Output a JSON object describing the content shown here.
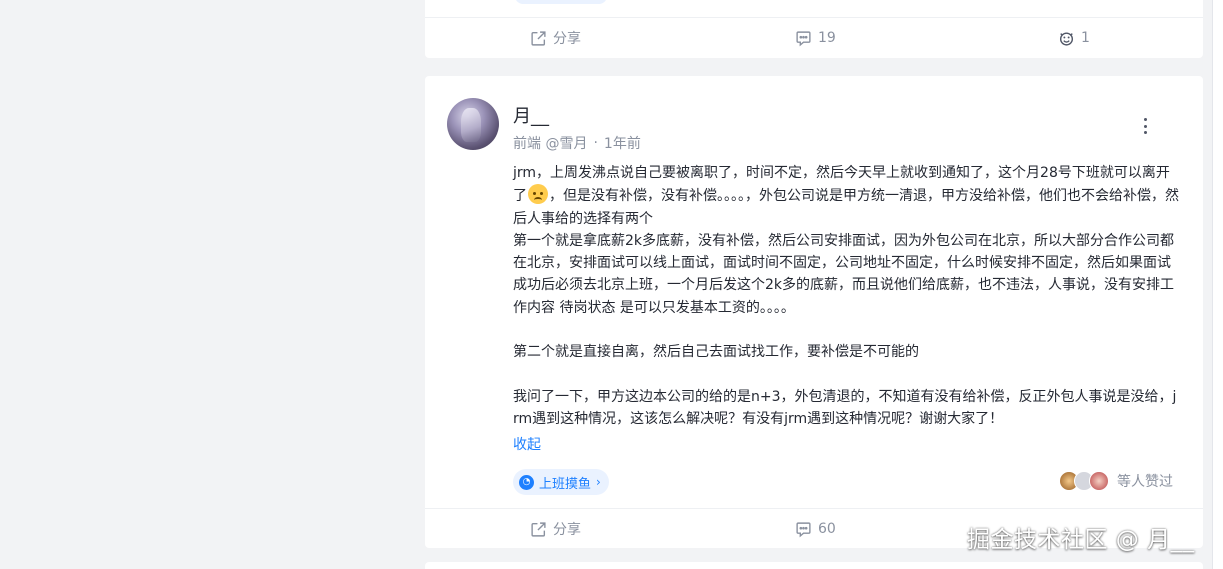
{
  "prev_post": {
    "actions": {
      "share_label": "分享",
      "comment_count": "19",
      "like_count": "1"
    }
  },
  "post": {
    "author": {
      "name": "月__",
      "title": "前端 @雪月",
      "separator": "·",
      "time": "1年前"
    },
    "content": {
      "p1a": "jrm，上周发沸点说自己要被离职了，时间不定，然后今天早上就收到通知了，这个月28号下班就可以离开了",
      "p1b": "，但是没有补偿，没有补偿。。。。，外包公司说是甲方统一清退，甲方没给补偿，他们也不会给补偿，然后人事给的选择有两个\n第一个就是拿底薪2k多底薪，没有补偿，然后公司安排面试，因为外包公司在北京，所以大部分合作公司都在北京，安排面试可以线上面试，面试时间不固定，公司地址不固定，什么时候安排不固定，然后如果面试成功后必须去北京上班，一个月后发这个2k多的底薪，而且说他们给底薪，也不违法，人事说，没有安排工作内容 待岗状态 是可以只发基本工资的。。。。\n\n第二个就是直接自离，然后自己去面试找工作，要补偿是不可能的\n\n我问了一下，甲方这边本公司的给的是n+3，外包清退的，不知道有没有给补偿，反正外包人事说是没给，jrm遇到这种情况，这该怎么解决呢？有没有jrm遇到这种情况呢？谢谢大家了！",
      "emoji_name": "crying-face-icon"
    },
    "collapse_label": "收起",
    "topic": {
      "label": "上班摸鱼",
      "chevron": "›"
    },
    "likers": {
      "label": "等人赞过"
    },
    "actions": {
      "share_label": "分享",
      "comment_count": "60"
    }
  },
  "watermark": "掘金技术社区 @ 月__",
  "colors": {
    "accent": "#1e80ff",
    "page_bg": "#f2f3f5",
    "muted_text": "#8a919f",
    "main_text": "#252933"
  }
}
